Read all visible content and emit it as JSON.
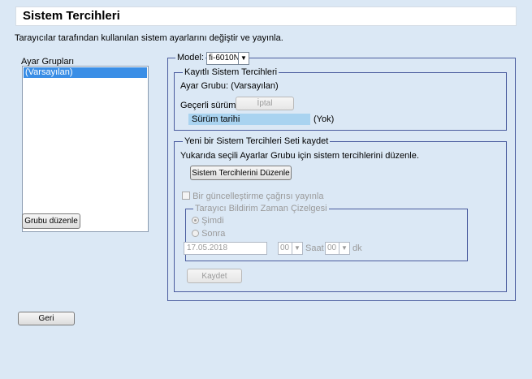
{
  "page": {
    "title": "Sistem Tercihleri",
    "description": "Tarayıcılar tarafından kullanılan sistem ayarlarını değiştir ve yayınla."
  },
  "groups": {
    "label": "Ayar Grupları",
    "items": [
      {
        "label": "(Varsayılan)",
        "selected": true
      }
    ],
    "edit_button": "Grubu düzenle"
  },
  "model": {
    "label": "Model:",
    "value": "fi-6010N"
  },
  "saved": {
    "legend": "Kayıtlı Sistem Tercihleri",
    "group_text": "Ayar Grubu: (Varsayılan)",
    "current_version_label": "Geçerli sürüm",
    "cancel_button": "İptal",
    "version_date_label": "Sürüm tarihi",
    "version_date_value": "(Yok)"
  },
  "new_set": {
    "legend": "Yeni bir Sistem Tercihleri Seti kaydet",
    "instruction": "Yukarıda seçili Ayarlar Grubu için sistem tercihlerini düzenle.",
    "edit_button": "Sistem Tercihlerini Düzenle",
    "publish_checkbox_label": "Bir güncelleştirme çağrısı yayınla",
    "publish_checked": false,
    "schedule": {
      "legend": "Tarayıcı Bildirim Zaman Çizelgesi",
      "now_label": "Şimdi",
      "later_label": "Sonra",
      "selected": "now",
      "date": "17.05.2018",
      "hour": "00",
      "hour_label": "Saat",
      "minute": "00",
      "minute_label": "dk"
    },
    "save_button": "Kaydet"
  },
  "back_button": "Geri",
  "colors": {
    "background": "#dbe8f5",
    "frame": "#4a5c9e",
    "selection": "#3a8ee6",
    "version_bar": "#a9d3f0"
  }
}
